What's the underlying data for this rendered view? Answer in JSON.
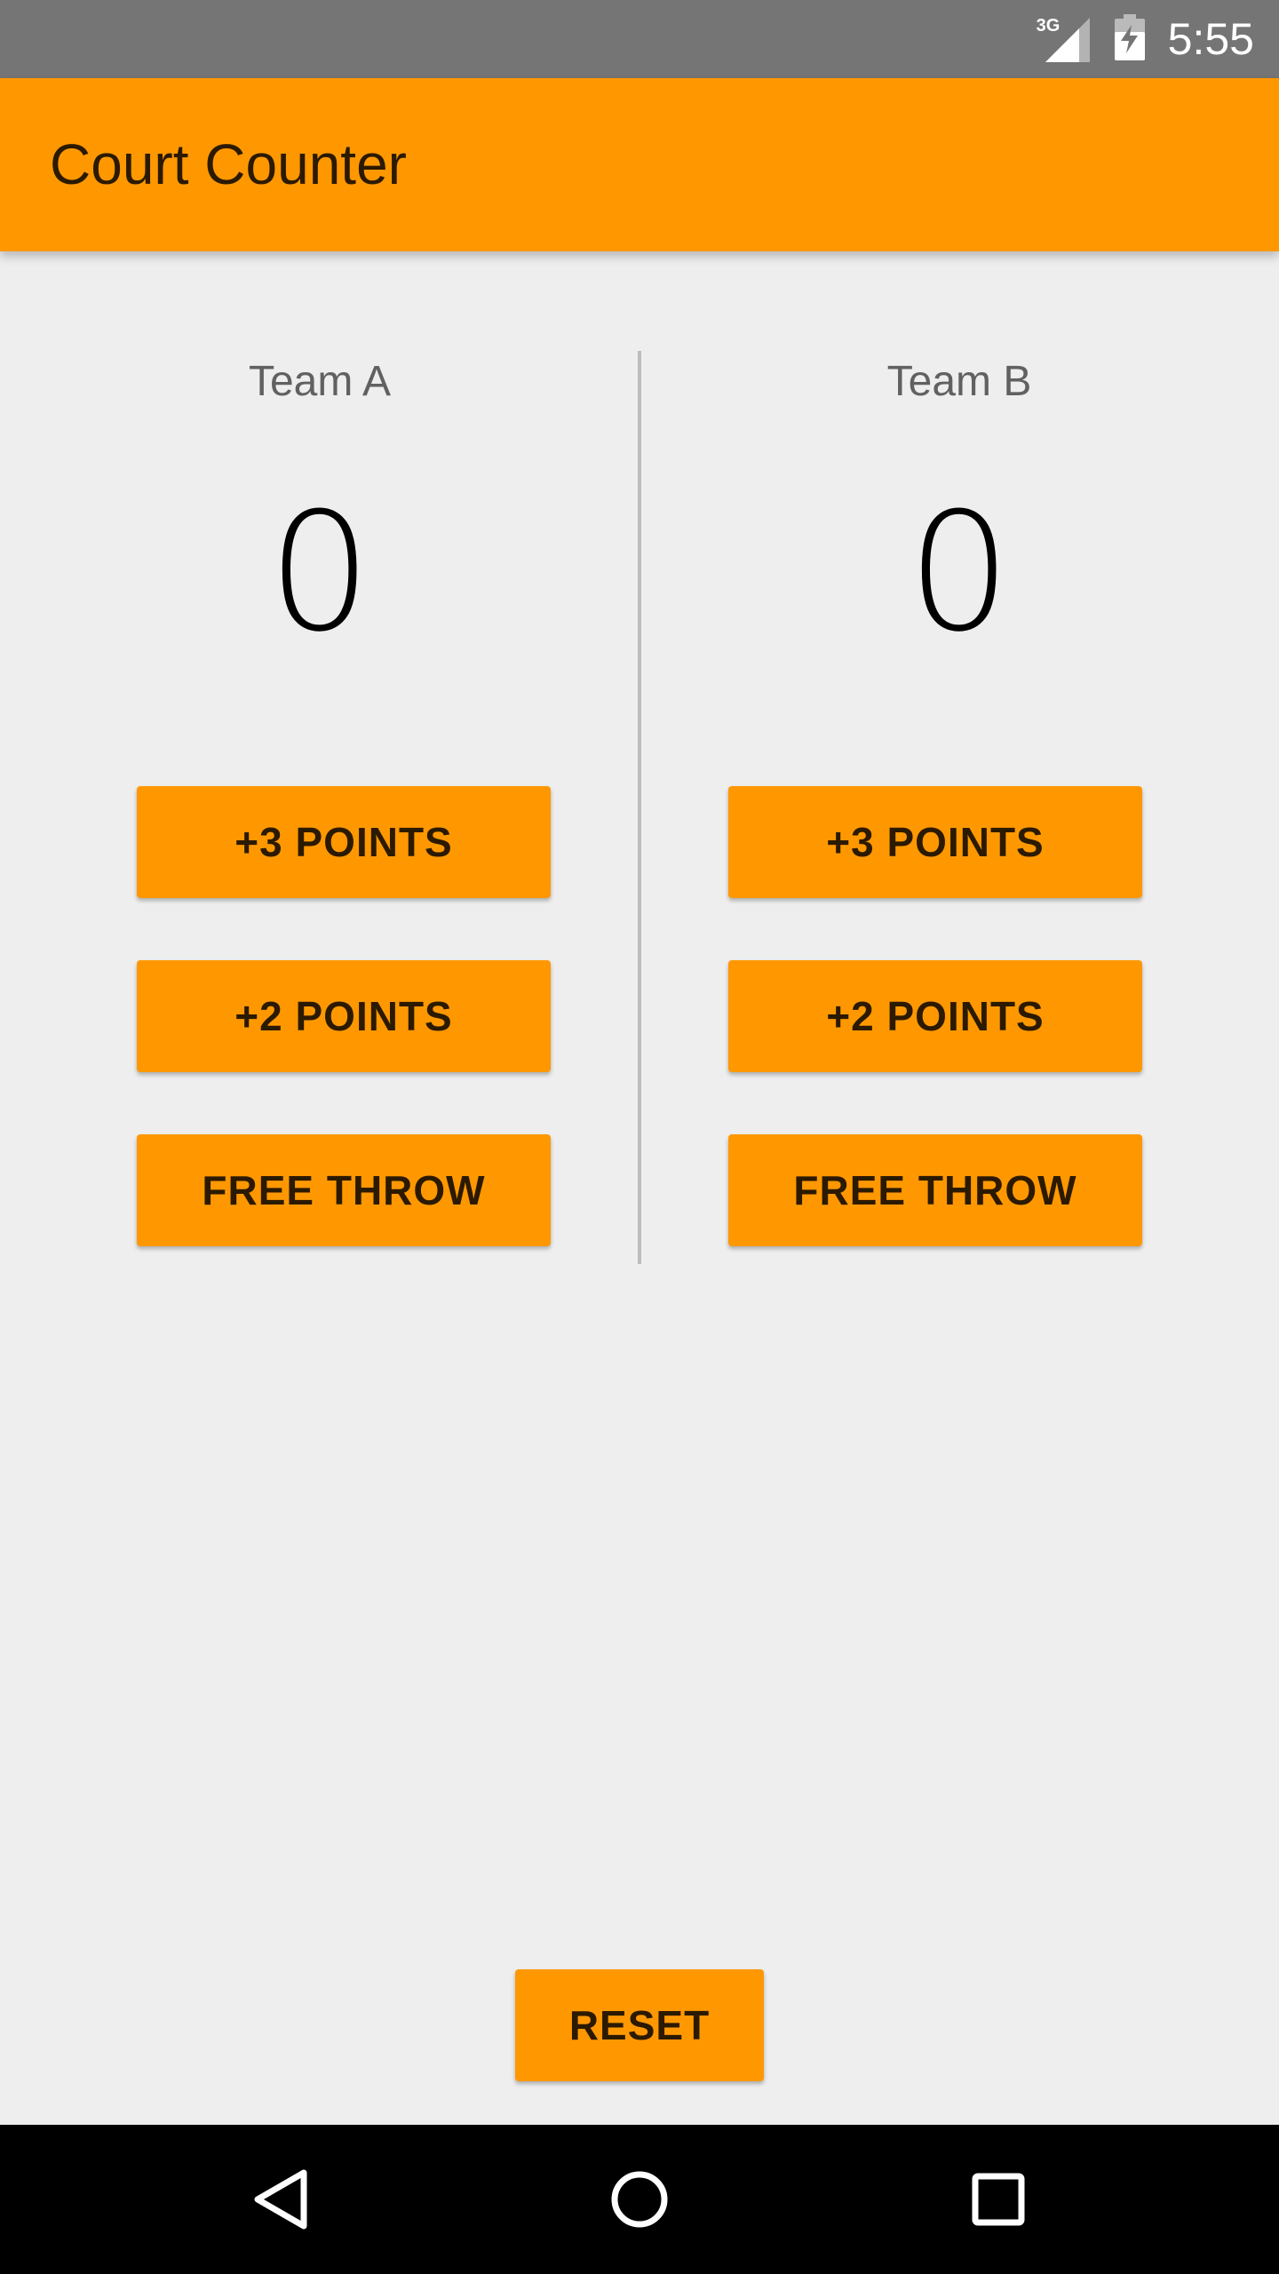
{
  "status_bar": {
    "network_type": "3G",
    "time": "5:55",
    "icons": [
      "signal-icon",
      "battery-charging-icon"
    ]
  },
  "app_bar": {
    "title": "Court Counter",
    "color": "#ff9800"
  },
  "teams": [
    {
      "name": "Team A",
      "score": "0",
      "buttons": [
        "+3 POINTS",
        "+2 POINTS",
        "FREE THROW"
      ]
    },
    {
      "name": "Team B",
      "score": "0",
      "buttons": [
        "+3 POINTS",
        "+2 POINTS",
        "FREE THROW"
      ]
    }
  ],
  "reset_label": "RESET",
  "nav_bar": {
    "icons": [
      "back-icon",
      "home-icon",
      "recents-icon"
    ]
  },
  "colors": {
    "accent": "#ff9800",
    "status_bar": "#757575",
    "background": "#eeeeee",
    "nav_bar": "#000000"
  }
}
